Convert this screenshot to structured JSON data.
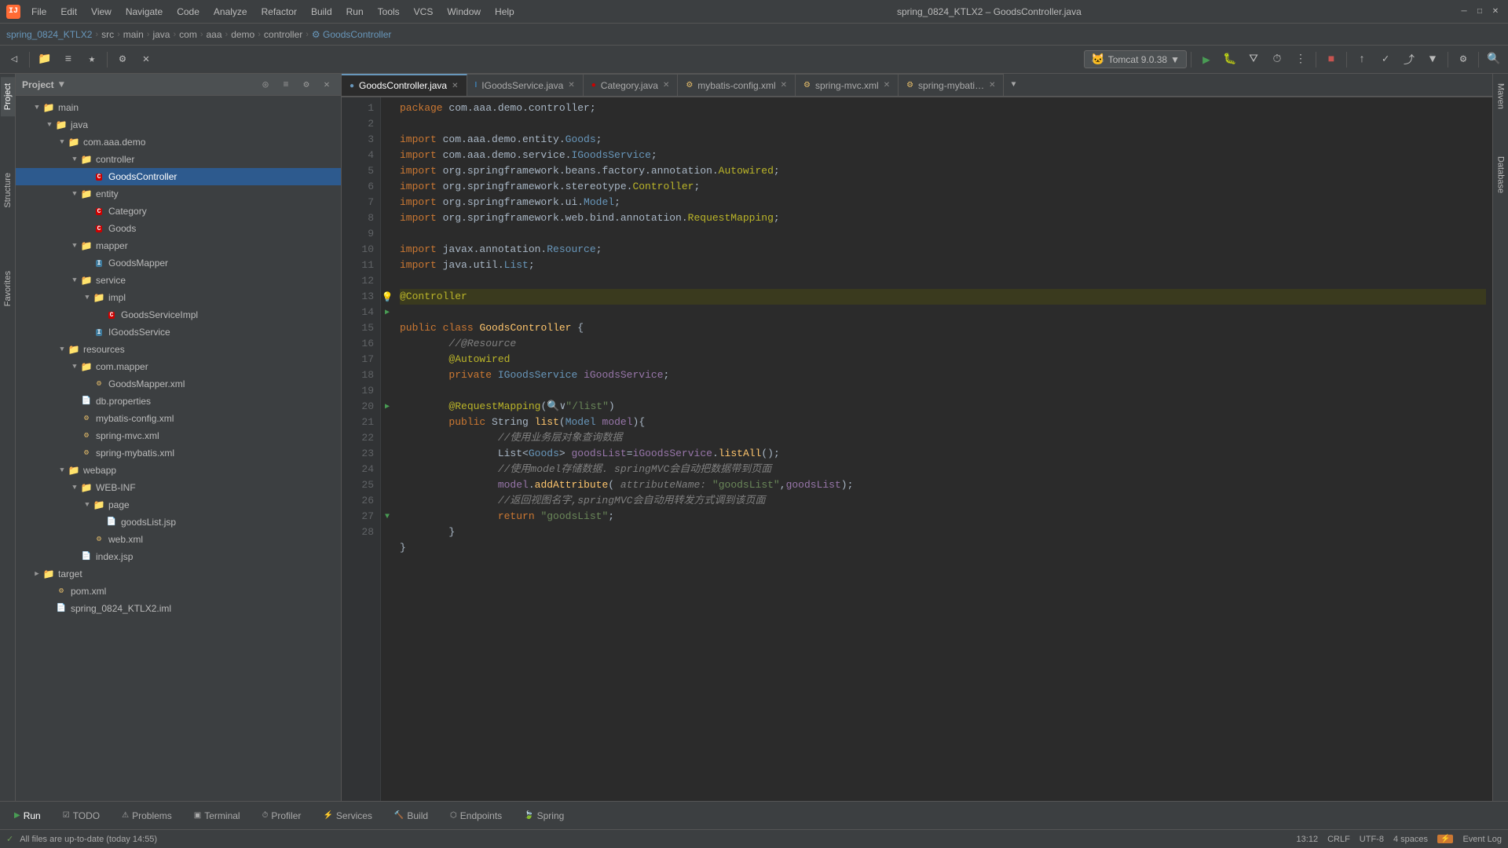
{
  "titleBar": {
    "logo": "IJ",
    "title": "spring_0824_KTLX2 – GoodsController.java",
    "menus": [
      "File",
      "Edit",
      "View",
      "Navigate",
      "Code",
      "Analyze",
      "Refactor",
      "Build",
      "Run",
      "Tools",
      "VCS",
      "Window",
      "Help"
    ],
    "runConfig": "Tomcat 9.0.38"
  },
  "breadcrumb": {
    "items": [
      "spring_0824_KTLX2",
      "src",
      "main",
      "java",
      "com",
      "aaa",
      "demo",
      "controller",
      "GoodsController"
    ]
  },
  "tabs": [
    {
      "label": "GoodsController.java",
      "icon": "C",
      "active": true
    },
    {
      "label": "IGoodsService.java",
      "icon": "I",
      "active": false
    },
    {
      "label": "Category.java",
      "icon": "C",
      "active": false
    },
    {
      "label": "mybatis-config.xml",
      "icon": "X",
      "active": false
    },
    {
      "label": "spring-mvc.xml",
      "icon": "X",
      "active": false
    },
    {
      "label": "spring-mybati…",
      "icon": "X",
      "active": false
    }
  ],
  "projectTree": {
    "header": "Project",
    "items": [
      {
        "indent": 0,
        "arrow": "▼",
        "icon": "folder",
        "label": "main",
        "type": "folder"
      },
      {
        "indent": 1,
        "arrow": "▼",
        "icon": "folder",
        "label": "java",
        "type": "folder"
      },
      {
        "indent": 2,
        "arrow": "▼",
        "icon": "folder",
        "label": "com.aaa.demo",
        "type": "folder"
      },
      {
        "indent": 3,
        "arrow": "▼",
        "icon": "folder",
        "label": "controller",
        "type": "folder"
      },
      {
        "indent": 4,
        "arrow": "",
        "icon": "C",
        "label": "GoodsController",
        "type": "class",
        "selected": true
      },
      {
        "indent": 3,
        "arrow": "▼",
        "icon": "folder",
        "label": "entity",
        "type": "folder"
      },
      {
        "indent": 4,
        "arrow": "",
        "icon": "C",
        "label": "Category",
        "type": "class"
      },
      {
        "indent": 4,
        "arrow": "",
        "icon": "C",
        "label": "Goods",
        "type": "class"
      },
      {
        "indent": 3,
        "arrow": "▼",
        "icon": "folder",
        "label": "mapper",
        "type": "folder"
      },
      {
        "indent": 4,
        "arrow": "",
        "icon": "I",
        "label": "GoodsMapper",
        "type": "interface"
      },
      {
        "indent": 3,
        "arrow": "▼",
        "icon": "folder",
        "label": "service",
        "type": "folder"
      },
      {
        "indent": 4,
        "arrow": "▼",
        "icon": "folder",
        "label": "impl",
        "type": "folder"
      },
      {
        "indent": 5,
        "arrow": "",
        "icon": "C",
        "label": "GoodsServiceImpl",
        "type": "class"
      },
      {
        "indent": 4,
        "arrow": "",
        "icon": "I",
        "label": "IGoodsService",
        "type": "interface"
      },
      {
        "indent": 2,
        "arrow": "▼",
        "icon": "folder",
        "label": "resources",
        "type": "folder"
      },
      {
        "indent": 3,
        "arrow": "▼",
        "icon": "folder",
        "label": "com.mapper",
        "type": "folder"
      },
      {
        "indent": 4,
        "arrow": "",
        "icon": "xml",
        "label": "GoodsMapper.xml",
        "type": "xml"
      },
      {
        "indent": 3,
        "arrow": "",
        "icon": "prop",
        "label": "db.properties",
        "type": "prop"
      },
      {
        "indent": 3,
        "arrow": "",
        "icon": "xml",
        "label": "mybatis-config.xml",
        "type": "xml"
      },
      {
        "indent": 3,
        "arrow": "",
        "icon": "xml",
        "label": "spring-mvc.xml",
        "type": "xml"
      },
      {
        "indent": 3,
        "arrow": "",
        "icon": "xml",
        "label": "spring-mybatis.xml",
        "type": "xml"
      },
      {
        "indent": 2,
        "arrow": "▼",
        "icon": "folder",
        "label": "webapp",
        "type": "folder"
      },
      {
        "indent": 3,
        "arrow": "▼",
        "icon": "folder",
        "label": "WEB-INF",
        "type": "folder"
      },
      {
        "indent": 4,
        "arrow": "▼",
        "icon": "folder",
        "label": "page",
        "type": "folder"
      },
      {
        "indent": 5,
        "arrow": "",
        "icon": "jsp",
        "label": "goodsList.jsp",
        "type": "jsp"
      },
      {
        "indent": 4,
        "arrow": "",
        "icon": "xml",
        "label": "web.xml",
        "type": "xml"
      },
      {
        "indent": 3,
        "arrow": "",
        "icon": "jsp",
        "label": "index.jsp",
        "type": "jsp"
      },
      {
        "indent": 0,
        "arrow": "▶",
        "icon": "folder",
        "label": "target",
        "type": "folder"
      },
      {
        "indent": 1,
        "arrow": "",
        "icon": "xml",
        "label": "pom.xml",
        "type": "xml"
      },
      {
        "indent": 1,
        "arrow": "",
        "icon": "xml",
        "label": "spring_0824_KTLX2.iml",
        "type": "xml"
      }
    ]
  },
  "codeLines": [
    {
      "num": 1,
      "text": "package com.aaa.demo.controller;"
    },
    {
      "num": 2,
      "text": ""
    },
    {
      "num": 3,
      "text": "import com.aaa.demo.entity.Goods;"
    },
    {
      "num": 4,
      "text": "import com.aaa.demo.service.IGoodsService;"
    },
    {
      "num": 5,
      "text": "import org.springframework.beans.factory.annotation.Autowired;"
    },
    {
      "num": 6,
      "text": "import org.springframework.stereotype.Controller;"
    },
    {
      "num": 7,
      "text": "import org.springframework.ui.Model;"
    },
    {
      "num": 8,
      "text": "import org.springframework.web.bind.annotation.RequestMapping;"
    },
    {
      "num": 9,
      "text": ""
    },
    {
      "num": 10,
      "text": "import javax.annotation.Resource;"
    },
    {
      "num": 11,
      "text": "import java.util.List;"
    },
    {
      "num": 12,
      "text": ""
    },
    {
      "num": 13,
      "text": "@Controller",
      "highlight": true
    },
    {
      "num": 14,
      "text": "public class GoodsController {"
    },
    {
      "num": 15,
      "text": "    //@Resource"
    },
    {
      "num": 16,
      "text": "    @Autowired"
    },
    {
      "num": 17,
      "text": "    private IGoodsService iGoodsService;"
    },
    {
      "num": 18,
      "text": ""
    },
    {
      "num": 19,
      "text": "    @RequestMapping(\"/list\")"
    },
    {
      "num": 20,
      "text": "    public String list(Model model){"
    },
    {
      "num": 21,
      "text": "        //使用业务层对象查询数据"
    },
    {
      "num": 22,
      "text": "        List<Goods> goodsList=iGoodsService.listAll();"
    },
    {
      "num": 23,
      "text": "        //使用model存储数据. springMVC会自动把数据带到页面"
    },
    {
      "num": 24,
      "text": "        model.addAttribute( attributeName: \"goodsList\",goodsList);"
    },
    {
      "num": 25,
      "text": "        //返回视图名字,springMVC会自动用转发方式调到该页面"
    },
    {
      "num": 26,
      "text": "        return \"goodsList\";"
    },
    {
      "num": 27,
      "text": "    }"
    },
    {
      "num": 28,
      "text": "}"
    }
  ],
  "bottomTabs": [
    "Run",
    "TODO",
    "Problems",
    "Terminal",
    "Profiler",
    "Services",
    "Build",
    "Endpoints",
    "Spring"
  ],
  "statusBar": {
    "message": "All files are up-to-date (today 14:55)",
    "position": "13:12",
    "encoding": "CRLF",
    "charset": "UTF-8",
    "indent": "4 spaces",
    "eventLog": "Event Log"
  }
}
